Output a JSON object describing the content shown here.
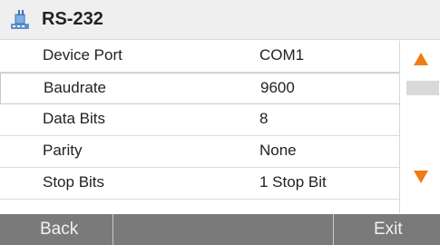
{
  "header": {
    "title": "RS-232",
    "icon": "plug-connector-icon"
  },
  "settings": [
    {
      "label": "Device Port",
      "value": "COM1"
    },
    {
      "label": "Baudrate",
      "value": "9600"
    },
    {
      "label": "Data Bits",
      "value": "8"
    },
    {
      "label": "Parity",
      "value": "None"
    },
    {
      "label": "Stop Bits",
      "value": "1 Stop Bit"
    }
  ],
  "scroll": {
    "up_icon": "arrow-up-icon",
    "down_icon": "arrow-down-icon",
    "arrow_color": "#ef7d14"
  },
  "footer": {
    "back_label": "Back",
    "exit_label": "Exit"
  },
  "colors": {
    "footer_bg": "#7a7a7a",
    "header_bg": "#efefef",
    "accent": "#ef7d14"
  }
}
